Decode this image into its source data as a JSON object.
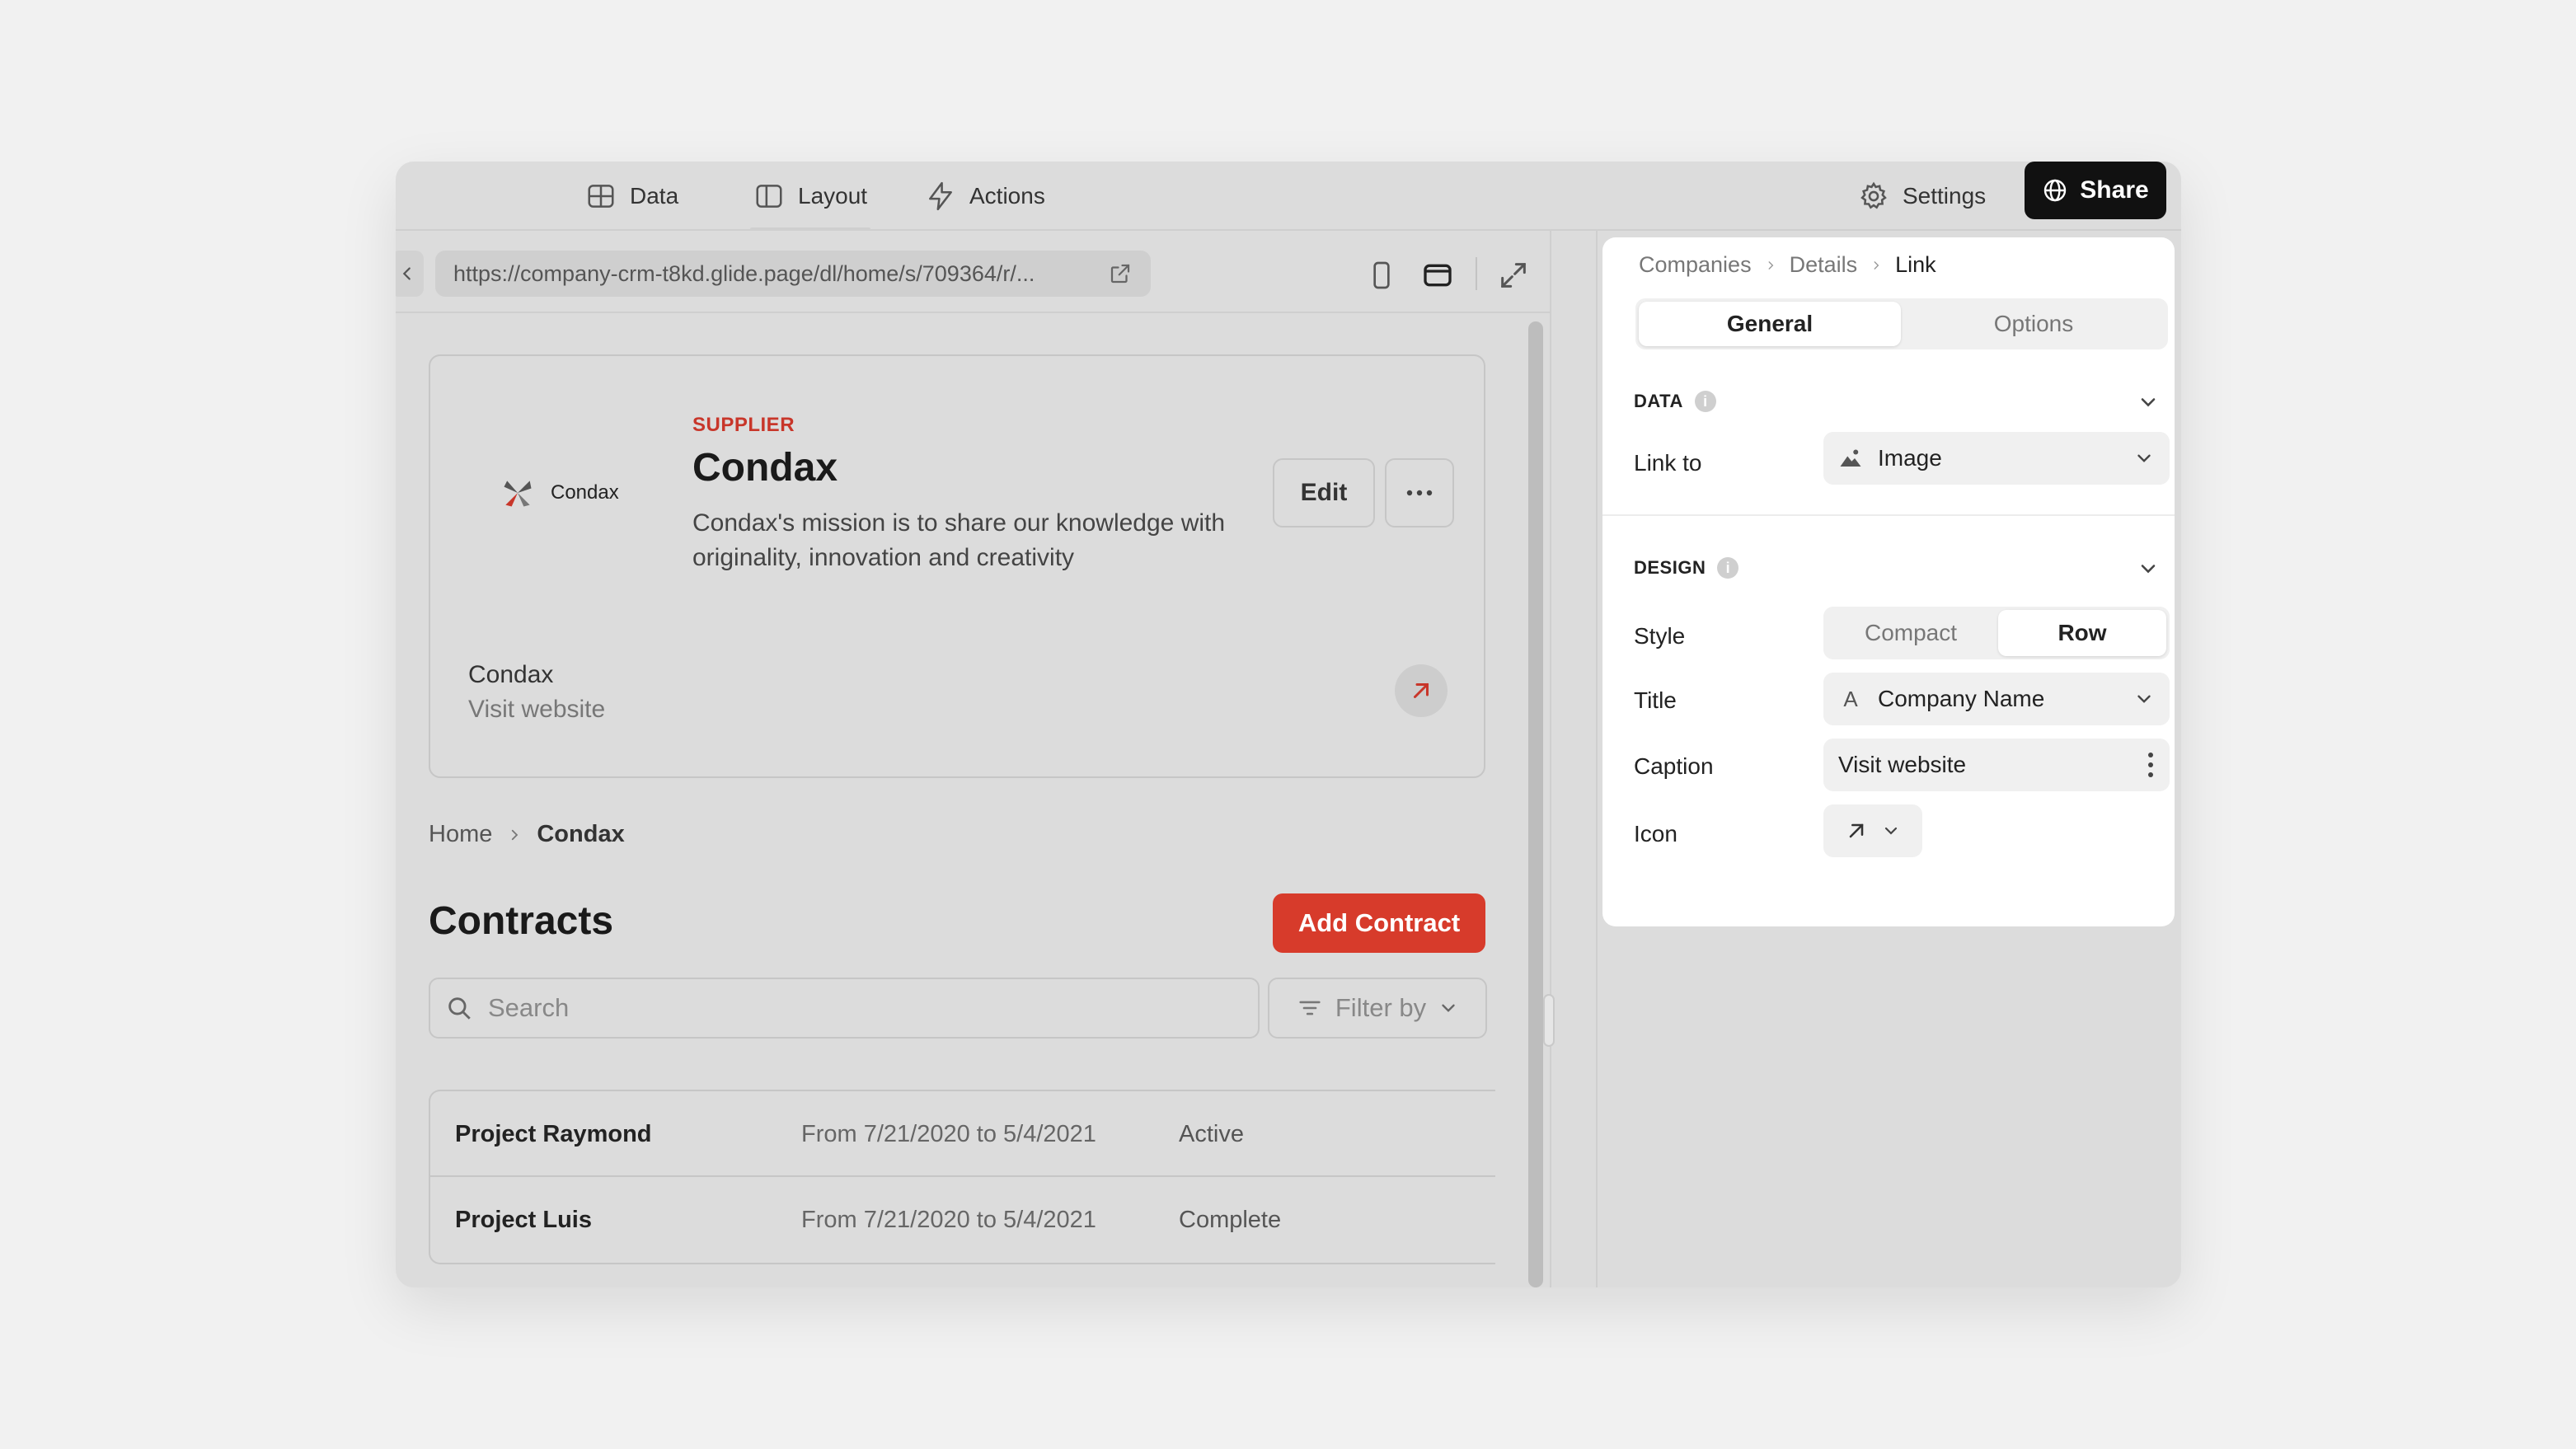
{
  "topbar": {
    "tabs": [
      {
        "label": "Data",
        "icon": "table-icon"
      },
      {
        "label": "Layout",
        "icon": "layout-icon"
      },
      {
        "label": "Actions",
        "icon": "bolt-icon"
      }
    ],
    "settings_label": "Settings",
    "share_label": "Share"
  },
  "preview": {
    "url": "https://company-crm-t8kd.glide.page/dl/home/s/709364/r/...",
    "card": {
      "logo_text": "Condax",
      "eyebrow": "SUPPLIER",
      "title": "Condax",
      "description": "Condax's mission is to share our knowledge with originality, innovation and creativity",
      "edit_label": "Edit",
      "link_title": "Condax",
      "link_caption": "Visit website"
    },
    "breadcrumb": {
      "home": "Home",
      "current": "Condax"
    },
    "section_title": "Contracts",
    "add_label": "Add Contract",
    "search_placeholder": "Search",
    "filter_label": "Filter by",
    "rows": [
      {
        "name": "Project Raymond",
        "dates": "From 7/21/2020 to 5/4/2021",
        "status": "Active"
      },
      {
        "name": "Project Luis",
        "dates": "From 7/21/2020 to 5/4/2021",
        "status": "Complete"
      }
    ]
  },
  "panel": {
    "breadcrumb": [
      "Companies",
      "Details",
      "Link"
    ],
    "tabs": {
      "general": "General",
      "options": "Options"
    },
    "data_section": {
      "heading": "DATA",
      "link_to_label": "Link to",
      "link_to_value": "Image"
    },
    "design_section": {
      "heading": "DESIGN",
      "style_label": "Style",
      "style_options": [
        "Compact",
        "Row"
      ],
      "title_label": "Title",
      "title_value": "Company Name",
      "caption_label": "Caption",
      "caption_value": "Visit website",
      "icon_label": "Icon"
    }
  },
  "colors": {
    "accent": "#d73b2b",
    "share_bg": "#111111"
  }
}
